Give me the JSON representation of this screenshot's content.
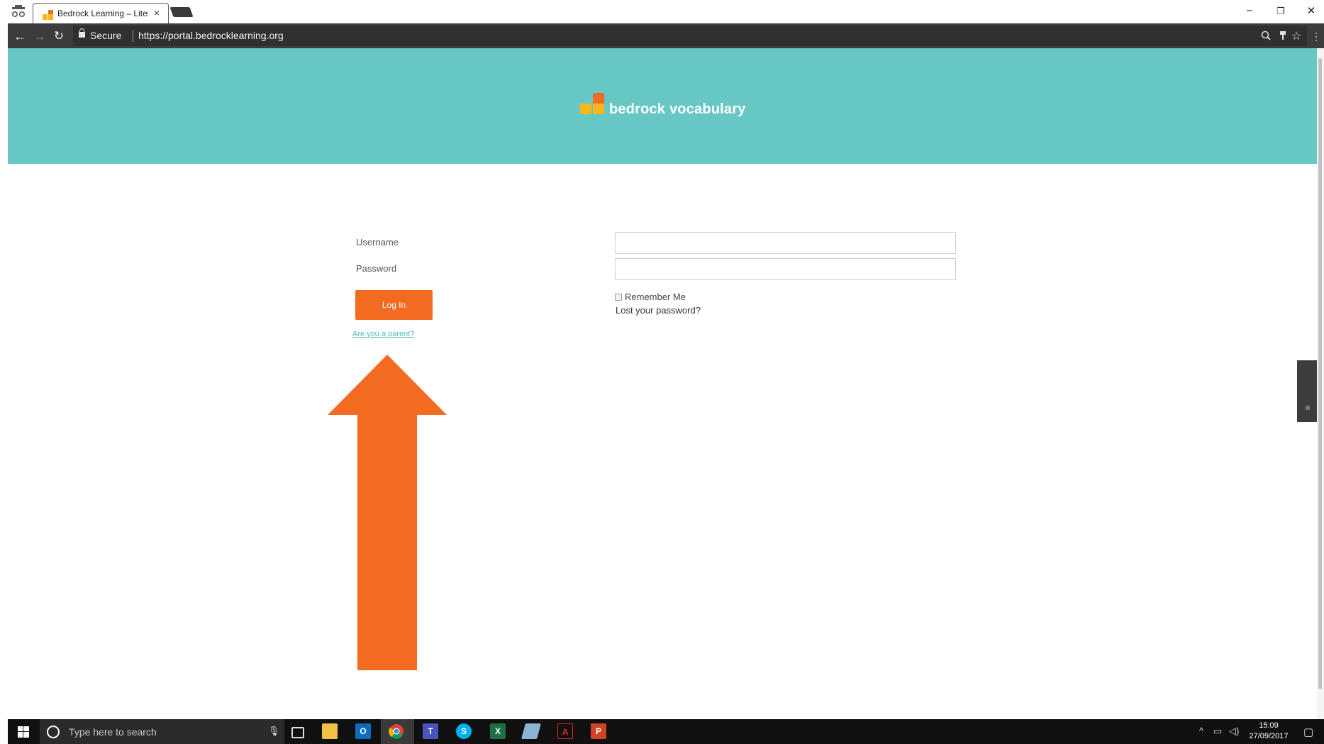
{
  "browser": {
    "tab_title": "Bedrock Learning – Liter",
    "tab_close": "×",
    "secure_label": "Secure",
    "url": "https://portal.bedrocklearning.org",
    "icons": [
      "incognito-icon",
      "back-icon",
      "forward-icon",
      "reload-icon",
      "lock-icon",
      "zoom-icon",
      "extension-icon",
      "bookmark-star-icon",
      "menu-icon"
    ],
    "window_controls": {
      "minimize": "–",
      "restore": "❐",
      "close": "✕"
    }
  },
  "header": {
    "brand": "bedrock vocabulary",
    "colors": {
      "banner": "#66c7c4",
      "accent": "#f26b21",
      "logo_yellow": "#f7b719"
    }
  },
  "login": {
    "username_label": "Username",
    "password_label": "Password",
    "username_value": "",
    "password_value": "",
    "login_button": "Log In",
    "parent_link": "Are you a parent?",
    "remember_me": "Remember Me",
    "remember_checked": false,
    "lost_password": "Lost your password?"
  },
  "annotation": {
    "arrow_color": "#f26b21"
  },
  "taskbar": {
    "search_placeholder": "Type here to search",
    "time": "15:09",
    "date": "27/09/2017",
    "apps": [
      "task-view",
      "file-explorer",
      "outlook",
      "chrome",
      "teams",
      "skype",
      "excel",
      "notes",
      "acrobat",
      "powerpoint"
    ]
  }
}
